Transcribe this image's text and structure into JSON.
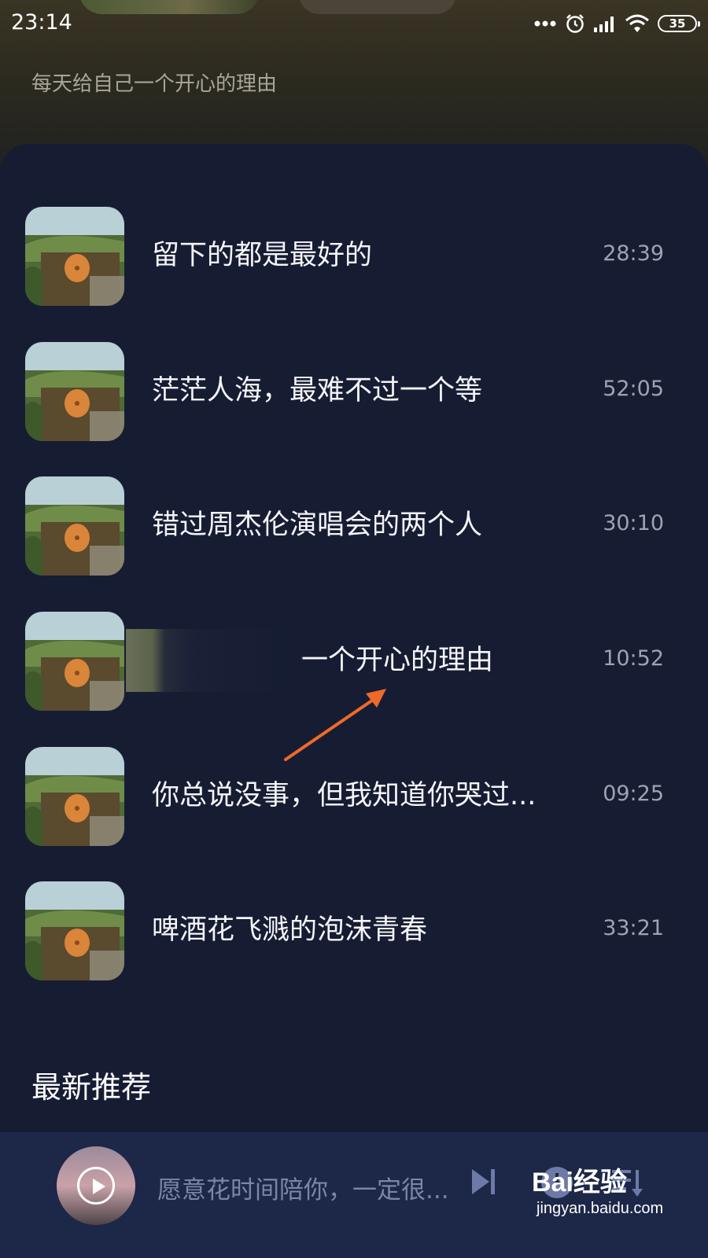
{
  "status_bar": {
    "time": "23:14",
    "battery": "35"
  },
  "header": {
    "subtitle": "每天给自己一个开心的理由"
  },
  "tracks": [
    {
      "title": "留下的都是最好的",
      "duration": "28:39"
    },
    {
      "title": "茫茫人海，最难不过一个等",
      "duration": "52:05"
    },
    {
      "title": "错过周杰伦演唱会的两个人",
      "duration": "30:10"
    },
    {
      "title": "一个开心的理由",
      "duration": "10:52"
    },
    {
      "title": "你总说没事，但我知道你哭过...",
      "duration": "09:25"
    },
    {
      "title": "啤酒花飞溅的泡沫青春",
      "duration": "33:21"
    }
  ],
  "section": {
    "latest_title": "最新推荐"
  },
  "player": {
    "now_playing": "愿意花时间陪你，一定很..."
  },
  "watermark": {
    "logo": "Bai经验",
    "url": "jingyan.baidu.com"
  },
  "colors": {
    "background": "#161d33",
    "player_bar": "#1d2747",
    "annotation_arrow": "#ee6a2a"
  },
  "icons": [
    "alarm-icon",
    "signal-icon",
    "wifi-icon",
    "battery-icon",
    "play-icon",
    "next-track-icon",
    "timer-icon",
    "playlist-icon"
  ]
}
